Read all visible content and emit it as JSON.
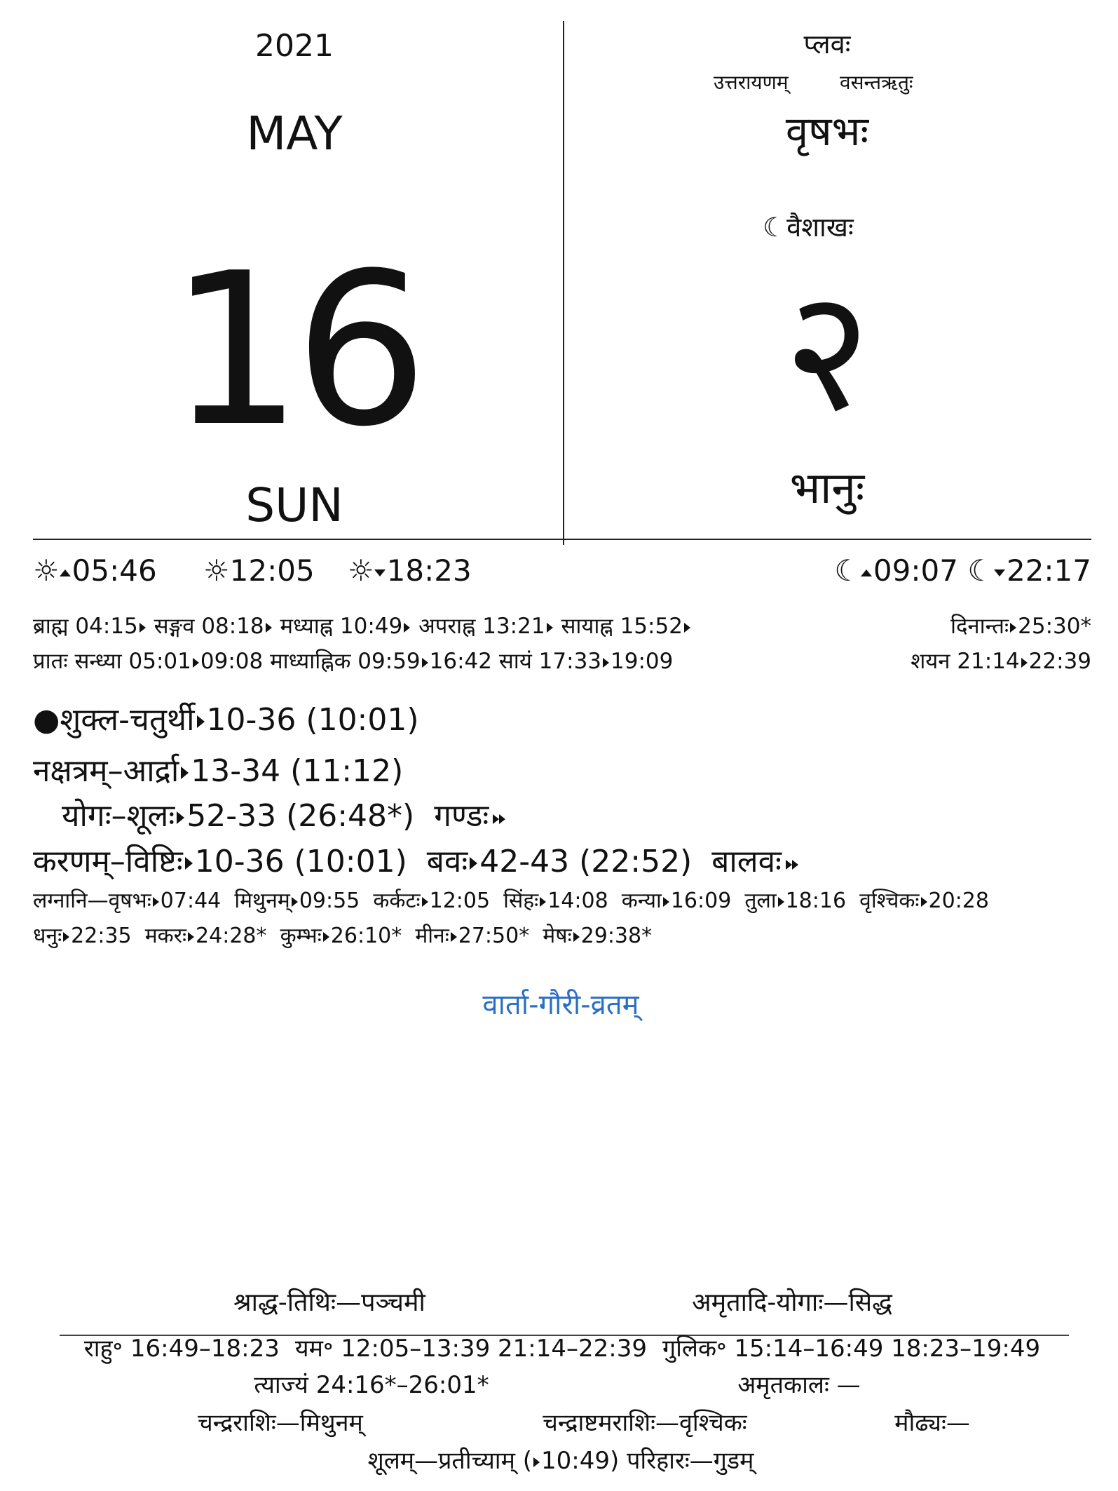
{
  "header": {
    "year": "2021",
    "month": "MAY",
    "day": "16",
    "weekday": "SUN",
    "samvatsara": "प्लवः",
    "ayana": "उत्तरायणम्",
    "ritu": "वसन्तऋतुः",
    "rashi_month": "वृषभः",
    "lunar_month": "वैशाखः",
    "lunar_day": "२",
    "vara": "भानुः"
  },
  "sun_times": {
    "sunrise": "05:46",
    "noon": "12:05",
    "sunset": "18:23"
  },
  "moon_times": {
    "moonrise": "09:07",
    "moonset": "22:17"
  },
  "kalas": {
    "row1": [
      {
        "label": "ब्राह्म",
        "time": "04:15"
      },
      {
        "label": "सङ्गव",
        "time": "08:18"
      },
      {
        "label": "मध्याह्न",
        "time": "10:49"
      },
      {
        "label": "अपराह्न",
        "time": "13:21"
      },
      {
        "label": "सायाह्न",
        "time": "15:52"
      }
    ],
    "dinanta_label": "दिनान्तः",
    "dinanta_time": "25:30*",
    "pratah_label": "प्रातः सन्ध्या",
    "pratah_start": "05:01",
    "pratah_end": "09:08",
    "madhyahnika_label": "माध्याह्निक",
    "madhyahnika_start": "09:59",
    "madhyahnika_end": "16:42",
    "sayam_label": "सायं",
    "sayam_start": "17:33",
    "sayam_end": "19:09",
    "shayana_label": "शयन",
    "shayana_start": "21:14",
    "shayana_end": "22:39"
  },
  "panchanga": {
    "tithi_name": "शुक्ल-चतुर्थी",
    "tithi_ghati": "10-36",
    "tithi_time": "(10:01)",
    "nakshatra_label": "नक्षत्रम्–आर्द्रा",
    "nakshatra_ghati": "13-34",
    "nakshatra_time": "(11:12)",
    "yoga_label": "योगः–शूलः",
    "yoga_ghati": "52-33",
    "yoga_time": "(26:48*)",
    "yoga_next": "गण्डः",
    "karana_label": "करणम्–विष्टिः",
    "karana_ghati": "10-36",
    "karana_time": "(10:01)",
    "karana2_label": "बवः",
    "karana2_ghati": "42-43",
    "karana2_time": "(22:52)",
    "karana_next": "बालवः"
  },
  "lagnas_label": "लग्नानि—वृषभः",
  "lagnas": [
    {
      "name": "",
      "time": "07:44"
    },
    {
      "name": "मिथुनम्",
      "time": "09:55"
    },
    {
      "name": "कर्कटः",
      "time": "12:05"
    },
    {
      "name": "सिंहः",
      "time": "14:08"
    },
    {
      "name": "कन्या",
      "time": "16:09"
    },
    {
      "name": "तुला",
      "time": "18:16"
    },
    {
      "name": "वृश्चिकः",
      "time": "20:28"
    }
  ],
  "lagnas2_first": "धनुः",
  "lagnas2": [
    {
      "name": "",
      "time": "22:35"
    },
    {
      "name": "मकरः",
      "time": "24:28*"
    },
    {
      "name": "कुम्भः",
      "time": "26:10*"
    },
    {
      "name": "मीनः",
      "time": "27:50*"
    },
    {
      "name": "मेषः",
      "time": "29:38*"
    }
  ],
  "festival": "वार्ता-गौरी-व्रतम्",
  "footer": {
    "shraddha": "श्राद्ध-तिथिः—पञ्चमी",
    "amritadi": "अमृतादि-योगाः—सिद्ध",
    "rahu": "राहु॰  16:49–18:23",
    "yama": "यम॰  12:05–13:39  21:14–22:39",
    "gulika": "गुलिक॰  15:14–16:49  18:23–19:49",
    "tyajyam": "त्याज्यं  24:16*–26:01*",
    "amritakala": "अमृतकालः  —",
    "chandrarashi": "चन्द्रराशिः—मिथुनम्",
    "chandrashtama": "चन्द्राष्टमराशिः—वृश्चिकः",
    "maudhya": "मौढ्यः—",
    "shulam": "शूलम्—प्रतीच्याम्",
    "shulam_time": "10:49",
    "parihara": "परिहारः—गुडम्"
  },
  "colors": {
    "festival": "#2a6fc4"
  }
}
